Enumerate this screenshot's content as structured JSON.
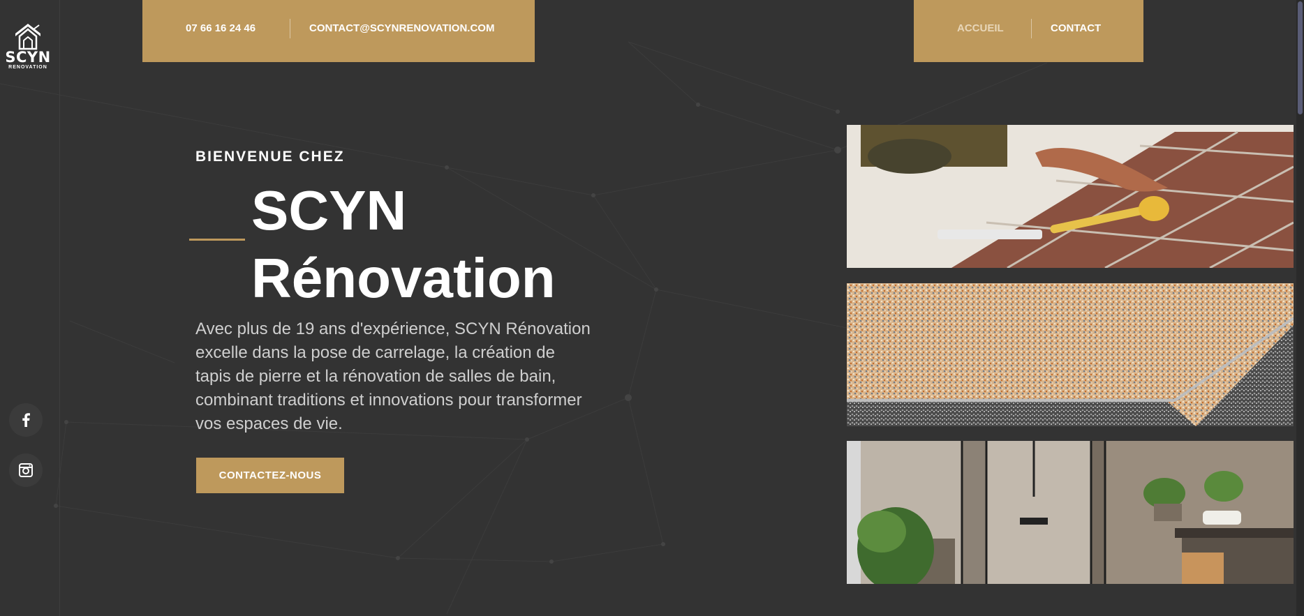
{
  "logo": {
    "name": "SCYN",
    "sub": "RENOVATION"
  },
  "contact_bar": {
    "phone": "07 66 16 24 46",
    "email": "CONTACT@SCYNRENOVATION.COM"
  },
  "nav": {
    "items": [
      {
        "label": "ACCUEIL"
      },
      {
        "label": "CONTACT"
      }
    ]
  },
  "hero": {
    "eyebrow": "BIENVENUE CHEZ",
    "title_line1": "SCYN",
    "title_line2": "Rénovation",
    "description": "Avec plus de 19 ans d'expérience, SCYN Rénovation excelle dans la pose de carrelage, la création de tapis de pierre et la rénovation de salles de bain, combinant traditions et innovations pour transformer vos espaces de vie.",
    "cta_label": "CONTACTEZ-NOUS"
  },
  "social": [
    {
      "icon": "facebook-icon"
    },
    {
      "icon": "instagram-icon"
    }
  ],
  "colors": {
    "accent": "#be995c",
    "background": "#333333",
    "text_muted": "#cfcfcf"
  }
}
